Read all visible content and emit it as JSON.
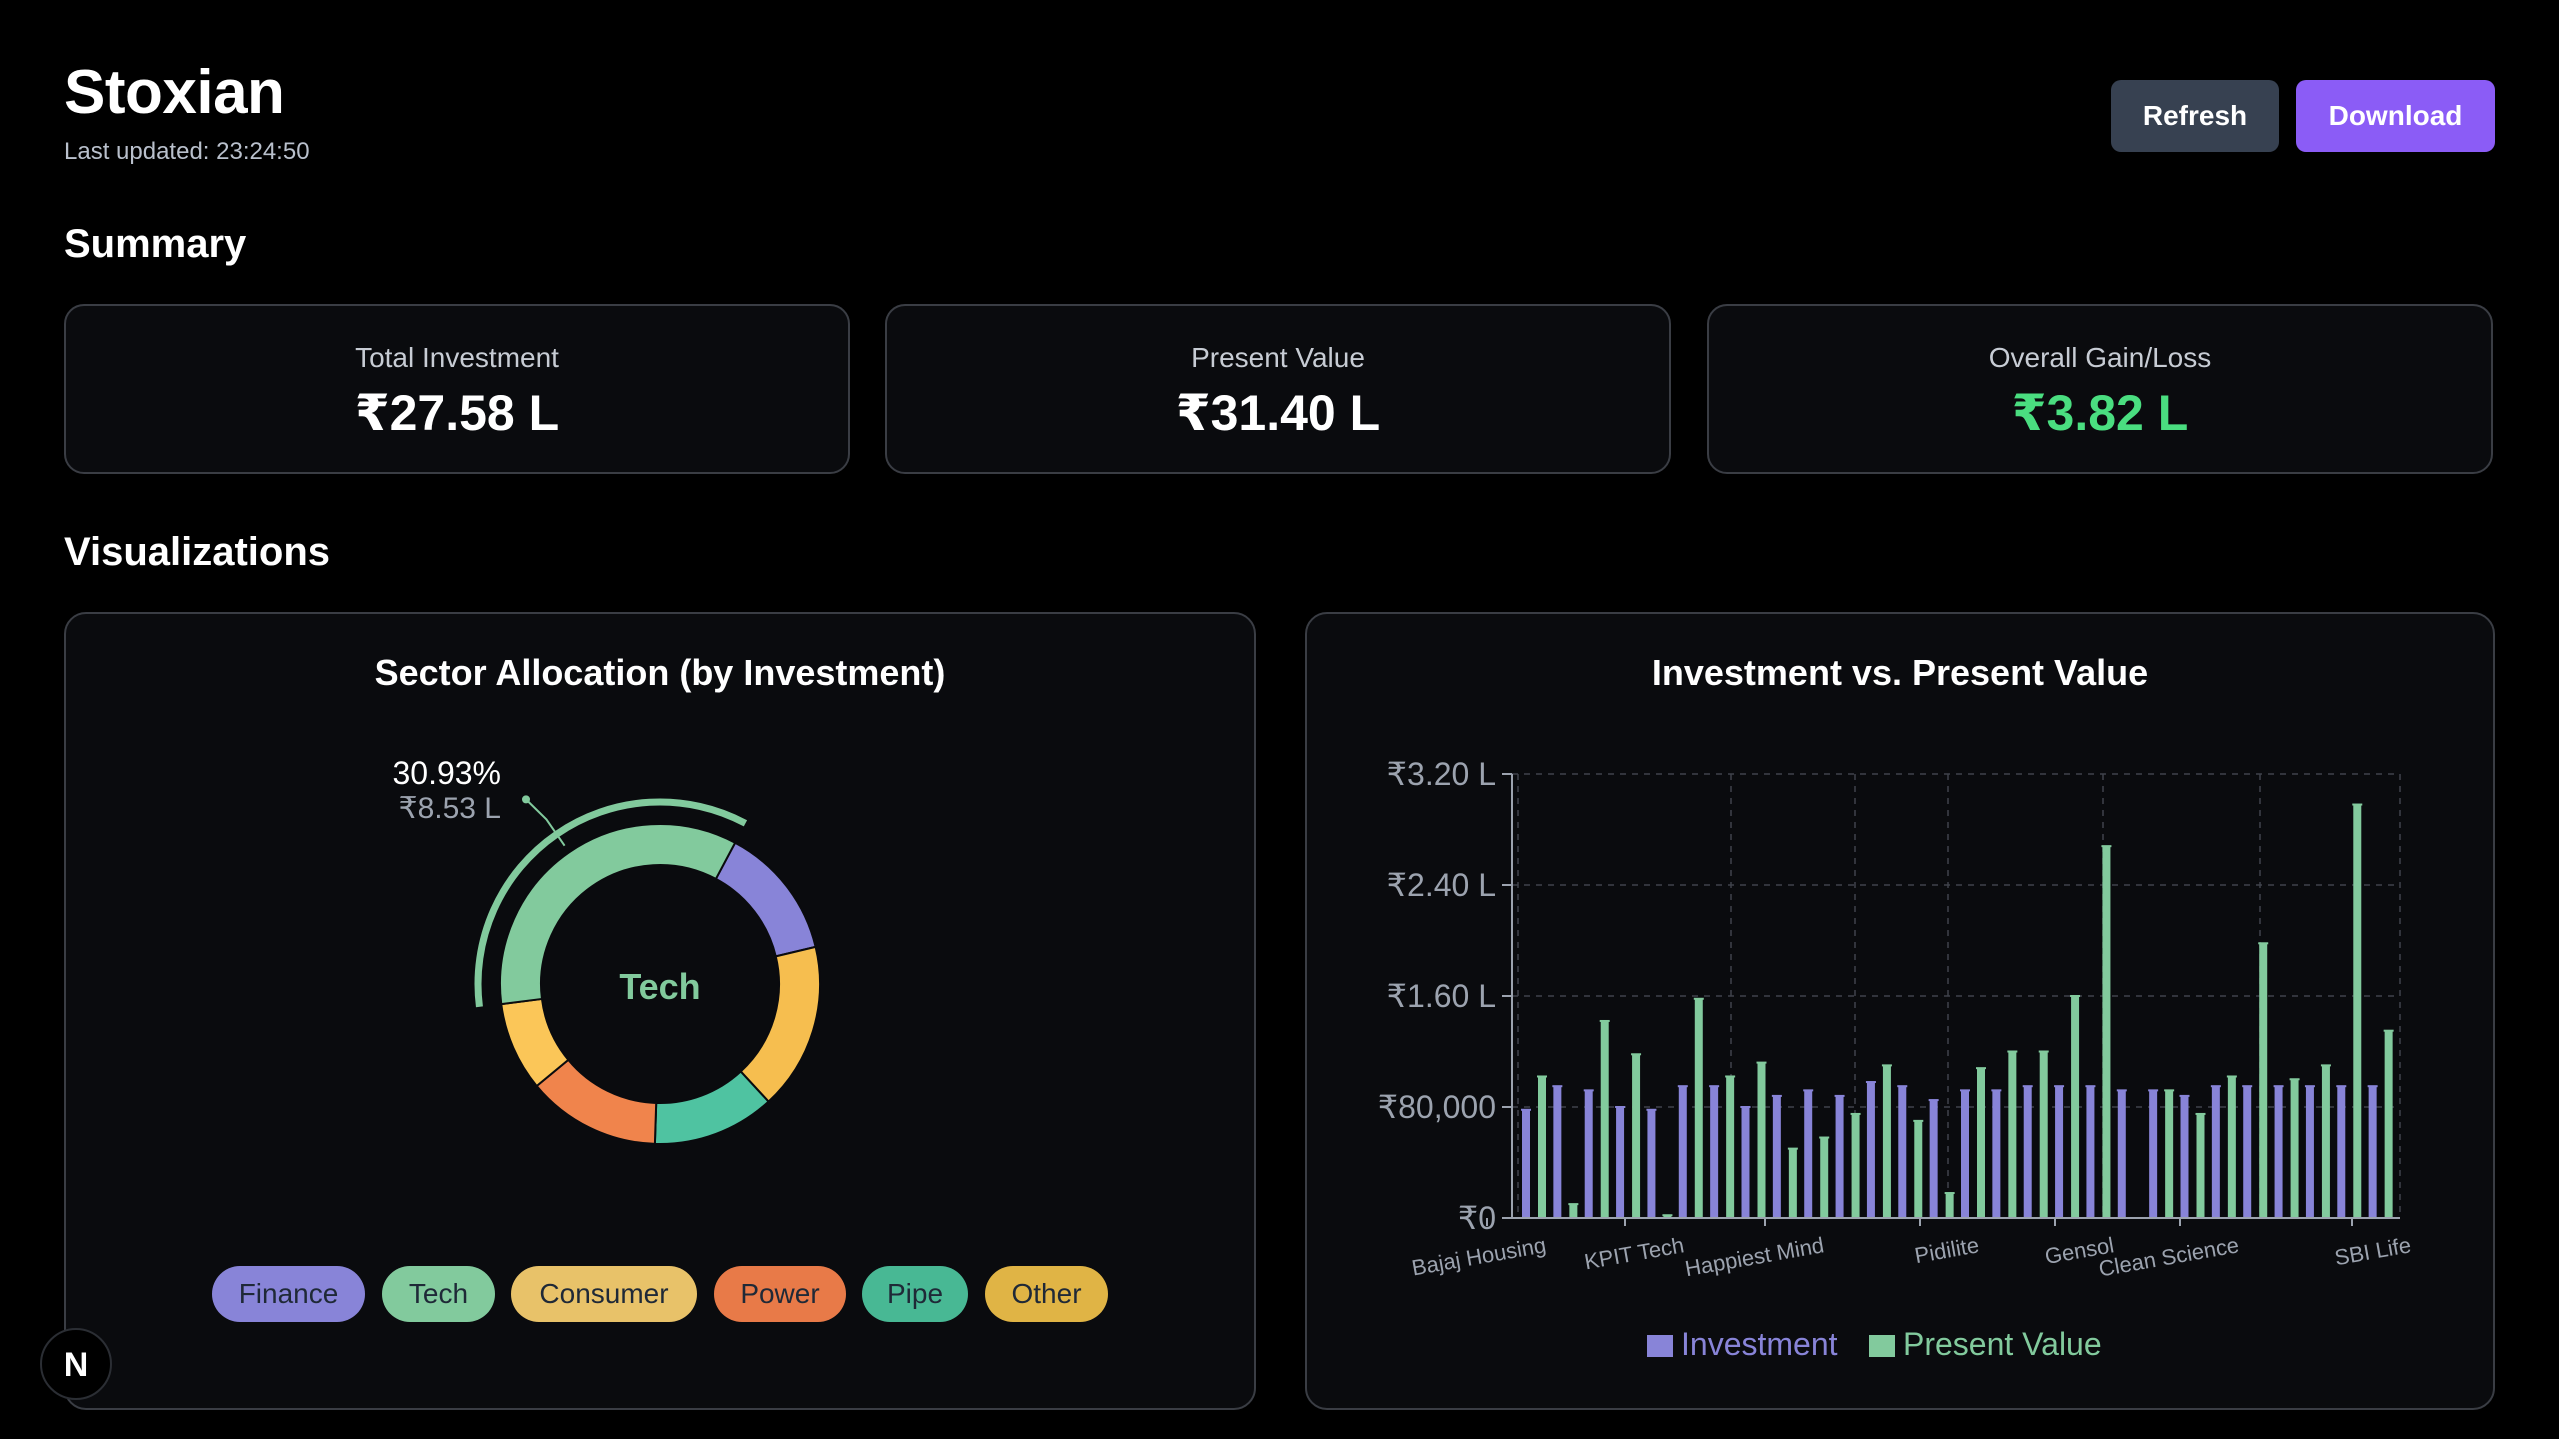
{
  "header": {
    "title": "Stoxian",
    "last_updated": "Last updated: 23:24:50",
    "refresh_label": "Refresh",
    "download_label": "Download"
  },
  "summary": {
    "title": "Summary",
    "cards": [
      {
        "label": "Total Investment",
        "value": "₹27.58 L",
        "color": "#ffffff"
      },
      {
        "label": "Present Value",
        "value": "₹31.40 L",
        "color": "#ffffff"
      },
      {
        "label": "Overall Gain/Loss",
        "value": "₹3.82 L",
        "color": "#4ade80"
      }
    ]
  },
  "visualizations": {
    "title": "Visualizations",
    "sector_chart": {
      "title": "Sector Allocation (by Investment)",
      "center_label": "Tech",
      "active_percent": "30.93%",
      "active_value": "₹8.53 L",
      "legend": [
        {
          "label": "Finance",
          "color": "#8884d8"
        },
        {
          "label": "Tech",
          "color": "#82ca9d"
        },
        {
          "label": "Consumer",
          "color": "#e8c269"
        },
        {
          "label": "Power",
          "color": "#e87a48"
        },
        {
          "label": "Pipe",
          "color": "#48b894"
        },
        {
          "label": "Other",
          "color": "#e0b445"
        }
      ]
    },
    "bar_chart": {
      "title": "Investment vs. Present Value",
      "y_ticks": [
        "₹0",
        "₹80,000",
        "₹1.60 L",
        "₹2.40 L",
        "₹3.20 L"
      ],
      "x_labels": [
        "Bajaj Housing",
        "KPIT Tech",
        "Happiest Mind",
        "Pidilite",
        "Gensol",
        "Clean Science",
        "SBI Life"
      ],
      "legend": [
        {
          "label": "Investment",
          "color": "#8884d8"
        },
        {
          "label": "Present Value",
          "color": "#82ca9d"
        }
      ]
    }
  },
  "chart_data": [
    {
      "type": "pie",
      "title": "Sector Allocation (by Investment)",
      "labels": [
        "Finance",
        "Tech",
        "Consumer",
        "Power",
        "Pipe",
        "Other"
      ],
      "values": [
        12.0,
        30.93,
        8.0,
        12.0,
        11.0,
        15.0
      ],
      "colors": [
        "#8884d8",
        "#82ca9d",
        "#fbc658",
        "#f0844c",
        "#4fc3a1",
        "#f6be4f"
      ],
      "segment_order": [
        "Finance",
        "Other",
        "Pipe",
        "Power",
        "Consumer",
        "Tech"
      ],
      "active": {
        "label": "Tech",
        "percent": "30.93%",
        "value": "₹8.53 L"
      }
    },
    {
      "type": "bar",
      "title": "Investment vs. Present Value",
      "ylim": [
        0,
        320000
      ],
      "y_ticks": [
        0,
        80000,
        160000,
        240000,
        320000
      ],
      "series": [
        {
          "name": "Investment",
          "color": "#8884d8",
          "values": [
            78000,
            95000,
            92000,
            80000,
            78000,
            95000,
            95000,
            80000,
            88000,
            92000,
            88000,
            98000,
            95000,
            85000,
            92000,
            92000,
            95000,
            95000,
            95000,
            92000,
            92000,
            88000,
            95000,
            95000,
            95000,
            95000,
            95000,
            95000
          ]
        },
        {
          "name": "Present Value",
          "color": "#82ca9d",
          "values": [
            102000,
            10000,
            142000,
            118000,
            2000,
            158000,
            102000,
            112000,
            50000,
            58000,
            75000,
            110000,
            70000,
            18000,
            108000,
            120000,
            120000,
            160000,
            268000,
            0,
            92000,
            75000,
            102000,
            198000,
            100000,
            110000,
            298000,
            135000
          ]
        }
      ],
      "x_labels": [
        "Bajaj Housing",
        "KPIT Tech",
        "Happiest Mind",
        "Pidilite",
        "Gensol",
        "Clean Science",
        "SBI Life"
      ],
      "legend_position": "bottom",
      "grid": true
    }
  ]
}
